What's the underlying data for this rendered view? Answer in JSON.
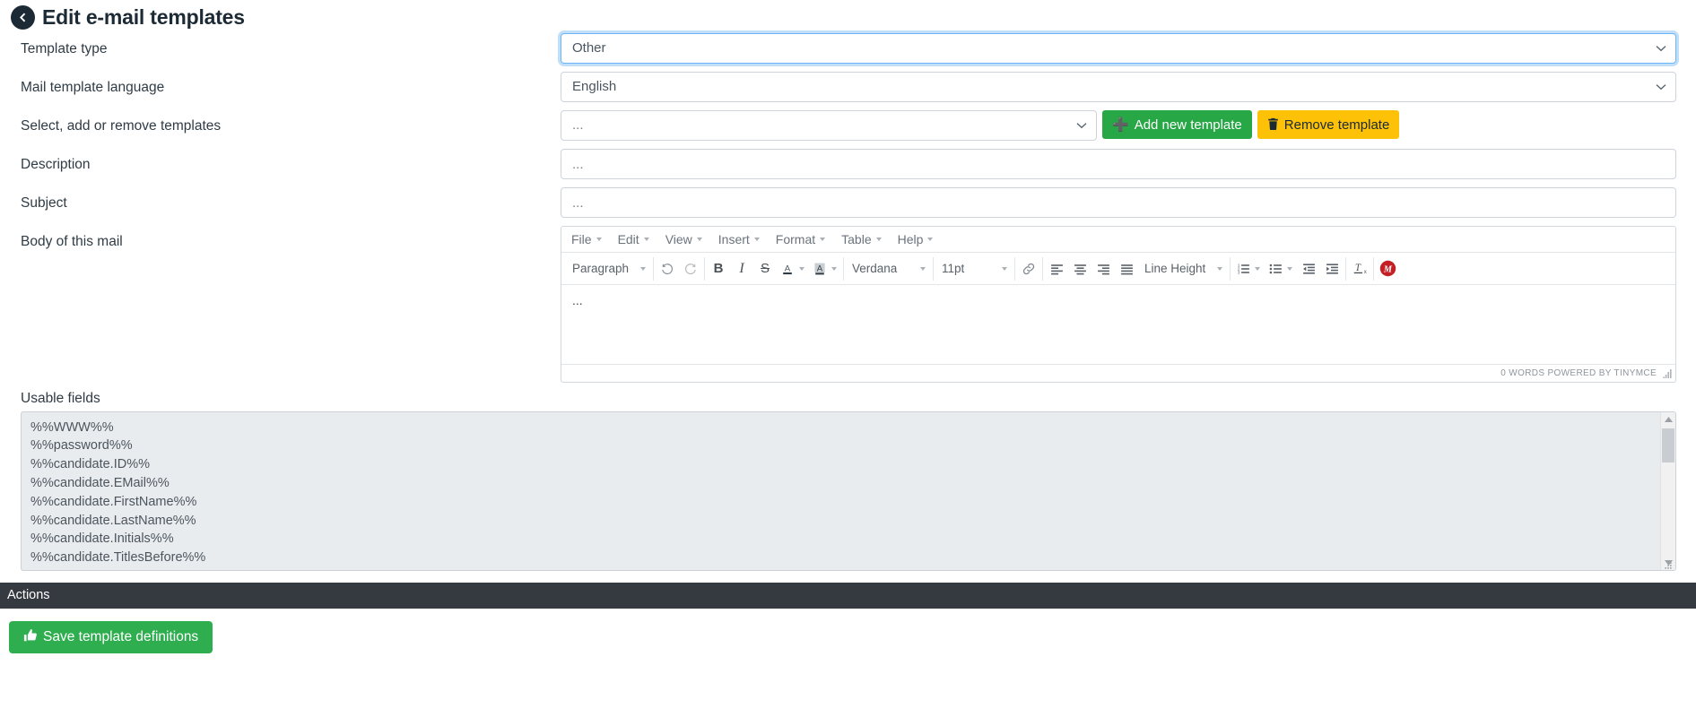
{
  "header": {
    "title": "Edit e-mail templates",
    "back_icon": "arrow-left-circle-icon"
  },
  "form": {
    "rows": [
      {
        "label": "Template type",
        "name": "template-type"
      },
      {
        "label": "Mail template language",
        "name": "mail-template-language"
      },
      {
        "label": "Select, add or remove templates",
        "name": "select-templates"
      },
      {
        "label": "Description",
        "name": "description"
      },
      {
        "label": "Subject",
        "name": "subject"
      },
      {
        "label": "Body of this mail",
        "name": "body-of-mail"
      }
    ],
    "template_type": {
      "value": "Other",
      "focused": true
    },
    "mail_template_language": {
      "value": "English"
    },
    "template_select": {
      "value": "..."
    },
    "description": {
      "value": "...",
      "placeholder": ""
    },
    "subject": {
      "value": "...",
      "placeholder": ""
    },
    "add_template_button": {
      "label": "Add new template",
      "icon": "plus-icon",
      "color": "#27a745"
    },
    "remove_template_button": {
      "label": "Remove template",
      "icon": "trash-icon",
      "color": "#fdc107"
    }
  },
  "editor": {
    "menubar": [
      {
        "label": "File"
      },
      {
        "label": "Edit"
      },
      {
        "label": "View"
      },
      {
        "label": "Insert"
      },
      {
        "label": "Format"
      },
      {
        "label": "Table"
      },
      {
        "label": "Help"
      }
    ],
    "toolbar": {
      "block_format": "Paragraph",
      "undo_icon": "undo-icon",
      "redo_icon": "redo-icon",
      "bold": "B",
      "italic": "I",
      "strikethrough": "S",
      "text_color_icon": "text-color-icon",
      "background_color_icon": "background-color-icon",
      "font_family": "Verdana",
      "font_size": "11pt",
      "link_icon": "link-icon",
      "align_left_icon": "align-left-icon",
      "align_center_icon": "align-center-icon",
      "align_right_icon": "align-right-icon",
      "align_justify_icon": "align-justify-icon",
      "line_height": "Line Height",
      "numbered_list_icon": "numbered-list-icon",
      "bullet_list_icon": "bullet-list-icon",
      "outdent_icon": "outdent-icon",
      "indent_icon": "indent-icon",
      "clear_format_icon": "remove-formatting-icon",
      "mailmerge_icon": "mailmerge-m-icon"
    },
    "content": "...",
    "status": "0 WORDS POWERED BY TINYMCE",
    "resize_handle_icon": "resize-handle-icon"
  },
  "usable_fields": {
    "label": "Usable fields",
    "items": [
      "%%WWW%%",
      "%%password%%",
      "%%candidate.ID%%",
      "%%candidate.EMail%%",
      "%%candidate.FirstName%%",
      "%%candidate.LastName%%",
      "%%candidate.Initials%%",
      "%%candidate.TitlesBefore%%"
    ],
    "scroll_up_icon": "scroll-up-arrow-icon",
    "scroll_down_icon": "scroll-down-arrow-icon",
    "resize_handle_icon": "resize-handle-icon"
  },
  "actions": {
    "title": "Actions",
    "save_button": {
      "label": "Save template definitions",
      "icon": "thumbs-up-icon",
      "color": "#2eae4e"
    }
  }
}
